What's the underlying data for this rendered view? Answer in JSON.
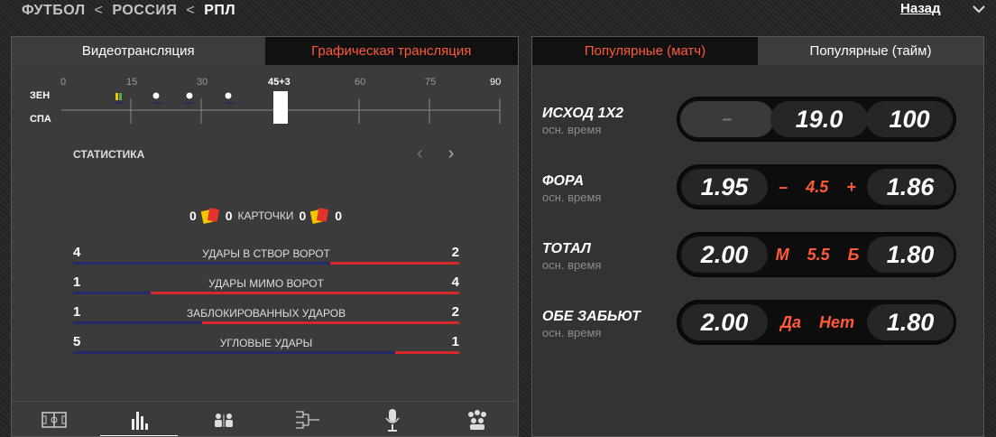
{
  "breadcrumb": {
    "items": [
      "ФУТБОЛ",
      "РОССИЯ"
    ],
    "current": "РПЛ",
    "separator": "<"
  },
  "back_label": "Назад",
  "left_tabs": [
    "Видеотрансляция",
    "Графическая трансляция"
  ],
  "timeline": {
    "team_home": "ЗЕН",
    "team_away": "СПА",
    "ticks": [
      "0",
      "15",
      "30",
      "45+3",
      "60",
      "75",
      "90"
    ],
    "progress_minute": 48
  },
  "stats": {
    "title": "СТАТИСТИКА",
    "cards": {
      "home_yellow": "0",
      "home_red": "0",
      "label": "КАРТОЧКИ",
      "away_yellow": "0",
      "away_red": "0"
    },
    "rows": [
      {
        "home": "4",
        "label": "УДАРЫ В СТВОР ВОРОТ",
        "away": "2"
      },
      {
        "home": "1",
        "label": "УДАРЫ МИМО ВОРОТ",
        "away": "4"
      },
      {
        "home": "1",
        "label": "ЗАБЛОКИРОВАННЫХ УДАРОВ",
        "away": "2"
      },
      {
        "home": "5",
        "label": "УГЛОВЫЕ УДАРЫ",
        "away": "1"
      }
    ]
  },
  "bottom_nav": [
    "field-icon",
    "stats-icon",
    "players-icon",
    "bracket-icon",
    "microphone-icon",
    "fans-icon"
  ],
  "right_tabs": [
    "Популярные (матч)",
    "Популярные (тайм)"
  ],
  "markets": [
    {
      "title": "ИСХОД 1X2",
      "sub": "осн. время",
      "a": "–",
      "mid": "19.0",
      "b": "100"
    },
    {
      "title": "ФОРА",
      "sub": "осн. время",
      "a": "1.95",
      "mid_l": "–",
      "mid_c": "4.5",
      "mid_r": "+",
      "b": "1.86"
    },
    {
      "title": "ТОТАЛ",
      "sub": "осн. время",
      "a": "2.00",
      "mid_l": "М",
      "mid_c": "5.5",
      "mid_r": "Б",
      "b": "1.80"
    },
    {
      "title": "ОБЕ ЗАБЬЮТ",
      "sub": "осн. время",
      "a": "2.00",
      "mid_l": "Да",
      "mid_r": "Нет",
      "b": "1.80"
    }
  ],
  "colors": {
    "accent": "#ff5a3c",
    "home_bar": "#252a6a",
    "away_bar": "#d8272a"
  }
}
